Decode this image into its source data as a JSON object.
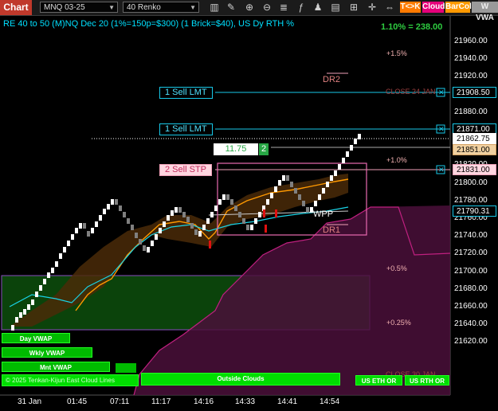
{
  "toolbar": {
    "chart_tab": "Chart",
    "instrument": "MNQ 03-25",
    "bar_type": "40 Renko",
    "buttons": [
      {
        "label": "T<>K",
        "color": "#ff7a00"
      },
      {
        "label": "Cloud",
        "color": "#e6007a"
      },
      {
        "label": "BarCol",
        "color": "#ff9900"
      },
      {
        "label": "W VWA",
        "color": "#aaaaaa"
      }
    ],
    "icons": [
      "bars-icon",
      "draw-icon",
      "zoom-in-icon",
      "zoom-out-icon",
      "properties-icon",
      "indicators-icon",
      "strategies-icon",
      "templates-icon",
      "data-box-icon"
    ]
  },
  "header_text": "RE 40 to 50 (M)NQ Dec 20 (1%=150p=$300) (1 Brick=$40), US Dy RTH %",
  "pct_display": "1.10% = 238.00",
  "price_axis": {
    "ticks": [
      "21960.00",
      "21940.00",
      "21920.00",
      "21900.00",
      "21880.00",
      "21860.00",
      "21840.00",
      "21820.00",
      "21800.00",
      "21780.00",
      "21760.00",
      "21740.00",
      "21720.00",
      "21700.00",
      "21680.00",
      "21660.00",
      "21640.00",
      "21620.00"
    ],
    "markers": [
      {
        "label": "21908.50",
        "kind": "order-lmt"
      },
      {
        "label": "21871.00",
        "kind": "order-lmt"
      },
      {
        "label": "21862.75",
        "kind": "last-price"
      },
      {
        "label": "21851.00",
        "kind": "position"
      },
      {
        "label": "21831.00",
        "kind": "order-stp"
      },
      {
        "label": "21790.31",
        "kind": "wpp"
      }
    ]
  },
  "time_axis": {
    "labels": [
      "31 Jan",
      "01:45",
      "07:11",
      "11:17",
      "14:16",
      "14:33",
      "14:41",
      "14:54"
    ]
  },
  "orders": [
    {
      "label": "1 Sell LMT",
      "type": "lmt"
    },
    {
      "label": "1 Sell LMT",
      "type": "lmt"
    },
    {
      "label": "2 Sell STP",
      "type": "stp"
    }
  ],
  "position": {
    "pnl": "11.75",
    "qty": "2"
  },
  "annotations": {
    "dr2": "DR2",
    "dr1": "DR1",
    "wpp": "WPP",
    "close_24": "CLOSE 24 JAN",
    "close_30": "CLOSE 30 JAN",
    "pct_1_5": "+1.5%",
    "pct_1_0": "+1.0%",
    "pct_0_5": "+0.5%",
    "pct_0_25": "+0.25%"
  },
  "pane_buttons": {
    "day_vwap": "Day VWAP",
    "wkly_vwap": "Wkly VWAP",
    "mnt_vwap": "Mnt VWAP",
    "outside_clouds": "Outside Clouds",
    "us_eth_or": "US ETH OR",
    "us_rth_or": "US RTH OR"
  },
  "copyright": "© 2025 Tenkan-Kijun East Cloud Lines",
  "colors": {
    "bullish_brick": "#ffffff",
    "bearish_brick": "#808080",
    "cloud_green": "#0f5a0f",
    "cloud_magenta": "#4a0f3a",
    "kijun_orange": "#ff9900",
    "vwap_cyan": "#19d3e6",
    "order_cyan": "#17c8e8",
    "stop_pink": "#f0a0b8"
  }
}
